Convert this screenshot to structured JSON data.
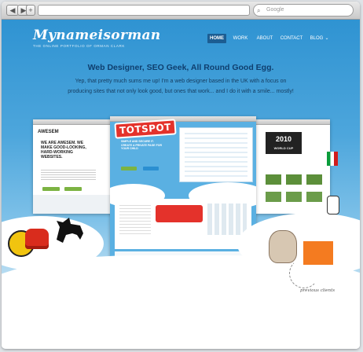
{
  "browser": {
    "back_label": "◀",
    "forward_label": "▶",
    "new_tab_label": "+",
    "search_placeholder": "Google",
    "search_icon": "magnifier-icon"
  },
  "site": {
    "logo": "Mynameisorman",
    "tagline": "THE ONLINE PORTFOLIO OF ORMAN CLARK"
  },
  "nav": [
    {
      "label": "HOME",
      "active": true
    },
    {
      "label": "WORK",
      "active": false
    },
    {
      "label": "ABOUT",
      "active": false
    },
    {
      "label": "CONTACT",
      "active": false
    },
    {
      "label": "BLOG",
      "active": false
    }
  ],
  "hero": {
    "headline": "Web Designer, SEO Geek, All Round Good Egg.",
    "intro": "Yep, that pretty much sums me up! I'm a web designer based in the UK with a focus on producing sites that not only look good, but ones that work... and I do it with a smile... mostly!"
  },
  "showcase": {
    "awesem": {
      "logo": "AWESEM",
      "headline": "WE ARE AWESEM. WE MAKE GOOD-LOOKING, HARD-WORKING WEBSITES."
    },
    "totspot": {
      "logo": "TOTSPOT",
      "tagline": "SIMPLE AND SECURE IT. CREATE A PRIVATE PAGE FOR YOUR CHILD"
    },
    "worldcup": {
      "title": "2010",
      "subtitle": "WORLD CUP"
    }
  },
  "previous_clients_label": "previous clients",
  "colors": {
    "sky_top": "#2f93d2",
    "nav_active": "#1c5d92",
    "headline": "#0f3f6f",
    "totspot_red": "#e4322b"
  }
}
